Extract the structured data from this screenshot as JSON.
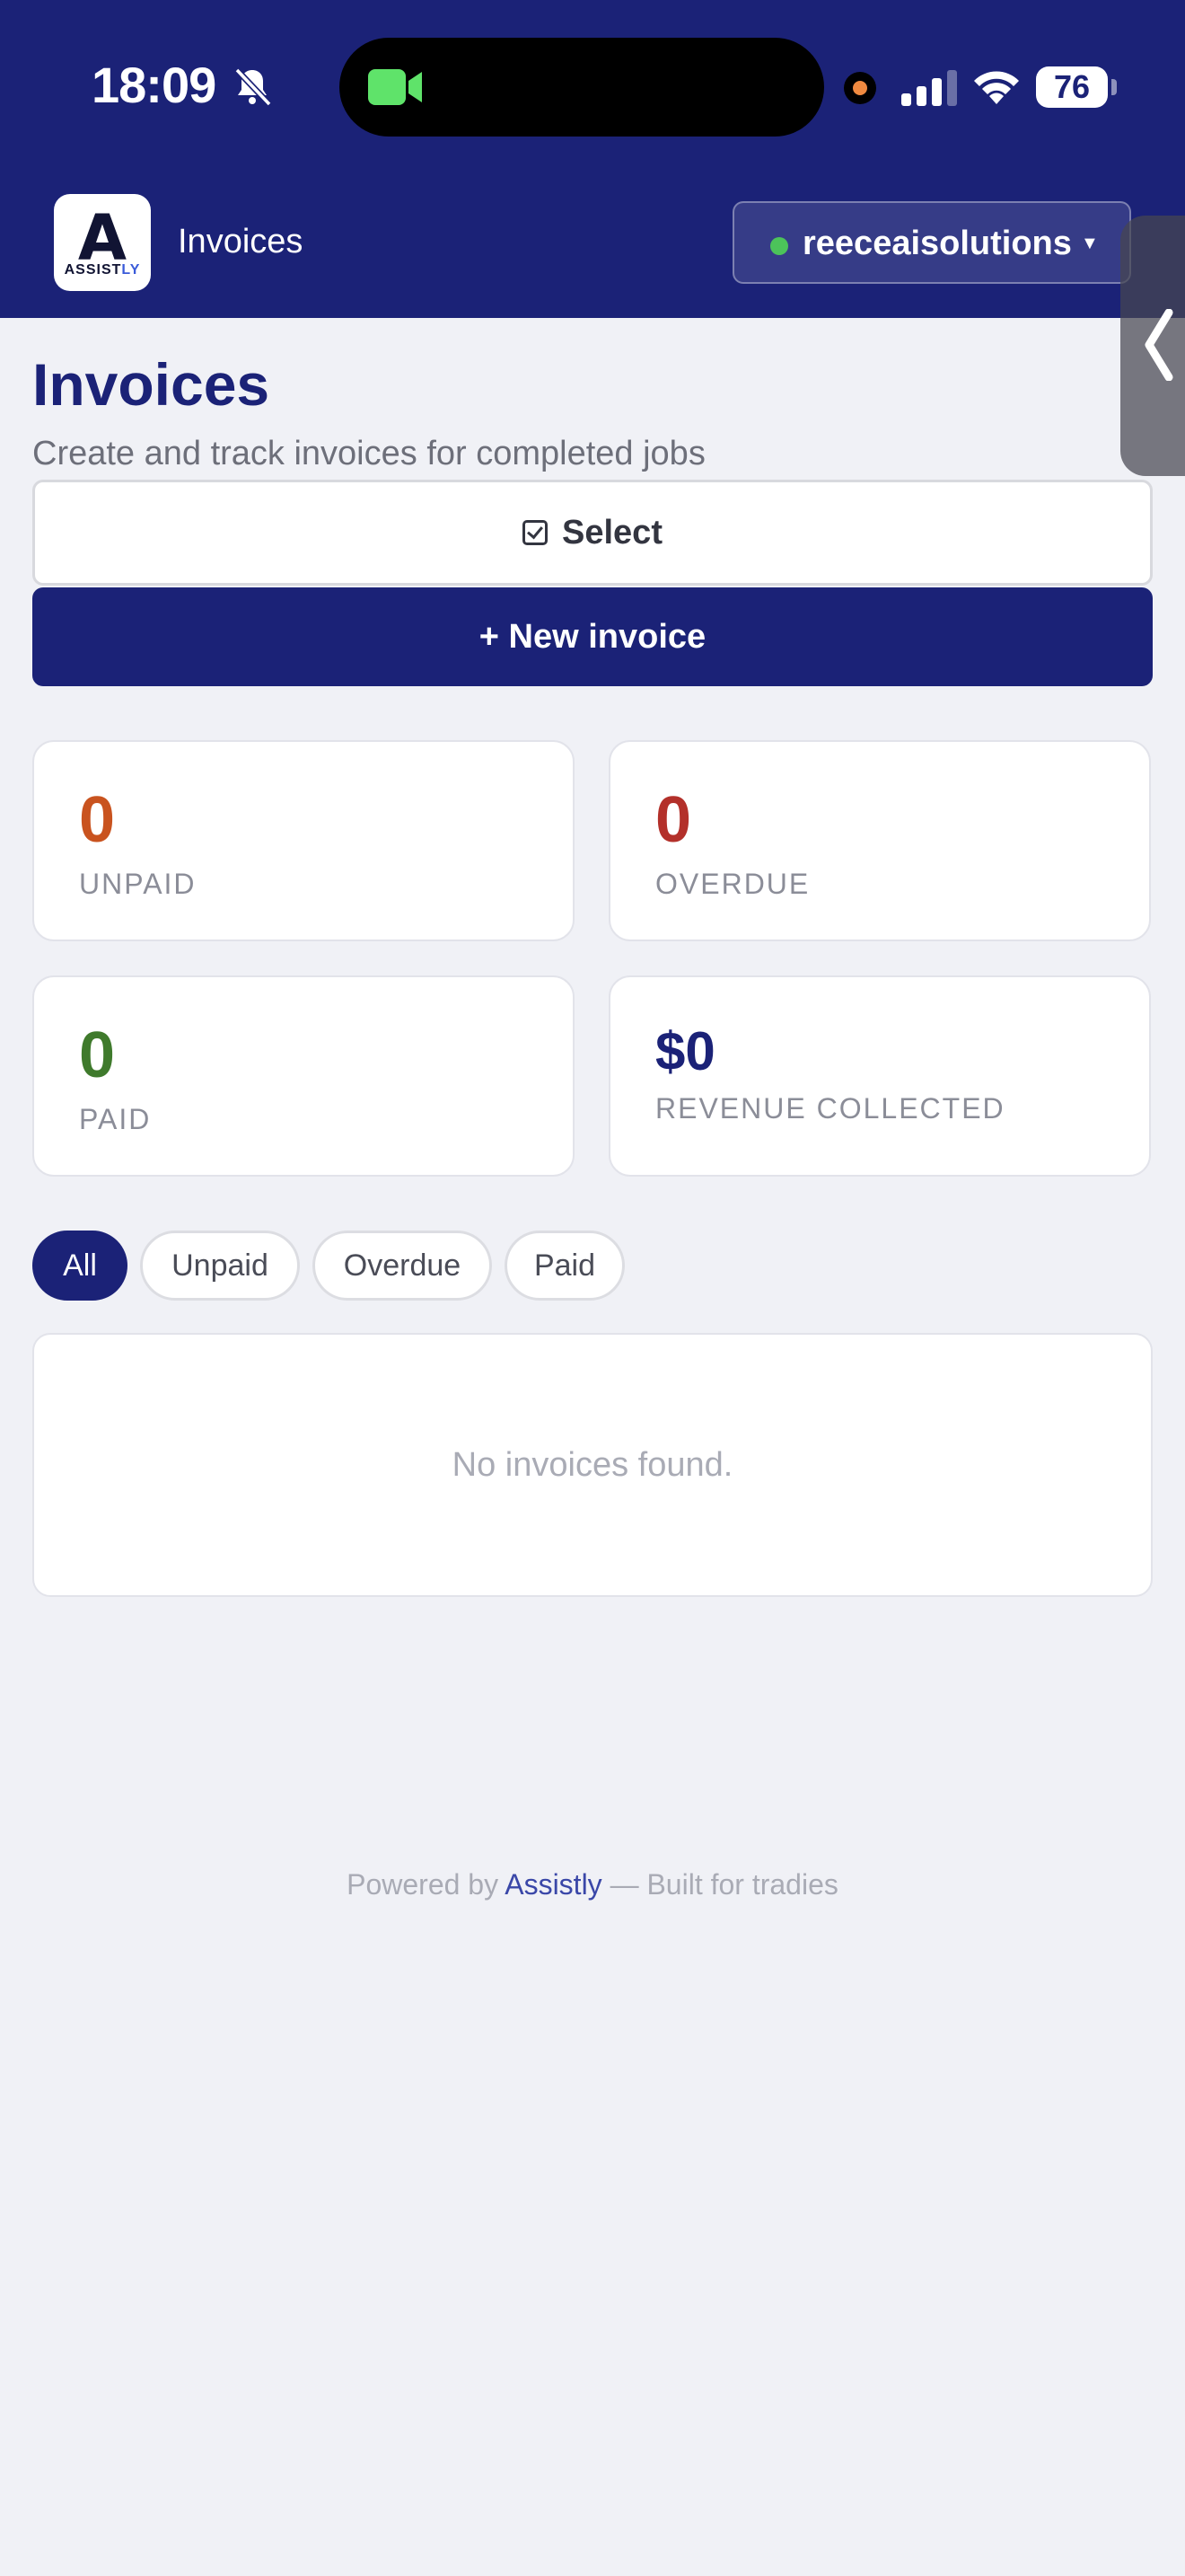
{
  "status_bar": {
    "time": "18:09",
    "battery": "76",
    "icons": [
      "bell-slash-icon",
      "facetime-camera-icon",
      "recording-dot-icon",
      "cellular-signal-icon",
      "wifi-icon",
      "battery-icon"
    ]
  },
  "app_bar": {
    "logo_letter": "A",
    "logo_word_main": "ASSIST",
    "logo_word_accent": "LY",
    "title": "Invoices",
    "tenant": "reeceaisolutions",
    "tenant_status_color": "#4cc35a"
  },
  "page": {
    "title": "Invoices",
    "subtitle": "Create and track invoices for completed jobs"
  },
  "actions": {
    "select_label": "Select",
    "new_invoice_label": "+ New invoice"
  },
  "stats": [
    {
      "value": "0",
      "label": "Unpaid",
      "color": "#c9531f"
    },
    {
      "value": "0",
      "label": "Overdue",
      "color": "#b3302a"
    },
    {
      "value": "0",
      "label": "Paid",
      "color": "#3f7a2c"
    },
    {
      "value": "$0",
      "label": "Revenue collected",
      "color": "#1b2277"
    }
  ],
  "filters": [
    {
      "label": "All",
      "active": true
    },
    {
      "label": "Unpaid",
      "active": false
    },
    {
      "label": "Overdue",
      "active": false
    },
    {
      "label": "Paid",
      "active": false
    }
  ],
  "empty_message": "No invoices found.",
  "footer": {
    "prefix": "Powered by",
    "brand": "Assistly",
    "suffix": "— Built for tradies"
  },
  "colors": {
    "brand": "#1b2277",
    "background": "#f0f1f6"
  }
}
